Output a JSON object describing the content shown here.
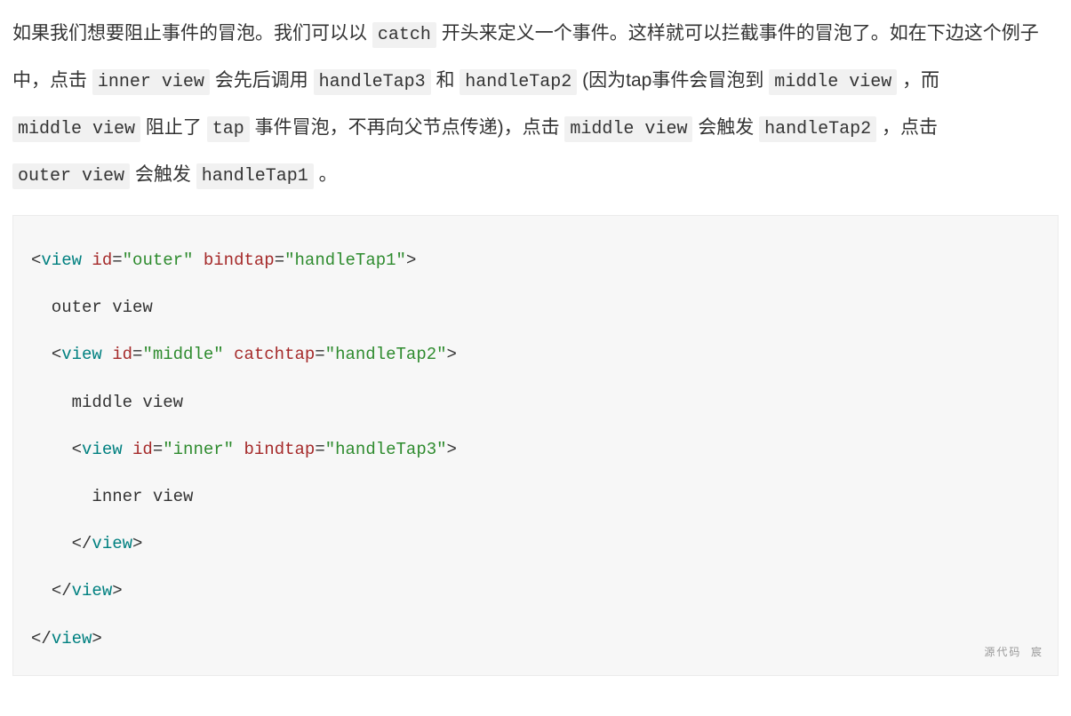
{
  "paragraph": {
    "p1": "如果我们想要阻止事件的冒泡。我们可以以",
    "c1": "catch",
    "p2": "开头来定义一个事件。这样就可以拦截事件的冒泡了。如在下边这个例子中，点击",
    "c2": "inner view",
    "p3": "会先后调用",
    "c3": "handleTap3",
    "p4": "和",
    "c4": "handleTap2",
    "p5": "(因为tap事件会冒泡到",
    "c5": "middle view",
    "p6": "，而",
    "c6": "middle view",
    "p7": "阻止了",
    "c7": "tap",
    "p8": "事件冒泡，不再向父节点传递)，点击",
    "c8": "middle view",
    "p9": "会触发",
    "c9": "handleTap2",
    "p10": "，点击",
    "c10": "outer view",
    "p11": "会触发",
    "c11": "handleTap1",
    "p12": "。"
  },
  "code": {
    "l1": {
      "lt": "<",
      "tag": "view",
      "sp1": " ",
      "a1": "id",
      "eq1": "=",
      "v1": "\"outer\"",
      "sp2": " ",
      "a2": "bindtap",
      "eq2": "=",
      "v2": "\"handleTap1\"",
      "gt": ">"
    },
    "l2": "  outer view",
    "l3": {
      "indent": "  ",
      "lt": "<",
      "tag": "view",
      "sp1": " ",
      "a1": "id",
      "eq1": "=",
      "v1": "\"middle\"",
      "sp2": " ",
      "a2": "catchtap",
      "eq2": "=",
      "v2": "\"handleTap2\"",
      "gt": ">"
    },
    "l4": "    middle view",
    "l5": {
      "indent": "    ",
      "lt": "<",
      "tag": "view",
      "sp1": " ",
      "a1": "id",
      "eq1": "=",
      "v1": "\"inner\"",
      "sp2": " ",
      "a2": "bindtap",
      "eq2": "=",
      "v2": "\"handleTap3\"",
      "gt": ">"
    },
    "l6": "      inner view",
    "l7": {
      "indent": "    ",
      "lt": "</",
      "tag": "view",
      "gt": ">"
    },
    "l8": {
      "indent": "  ",
      "lt": "</",
      "tag": "view",
      "gt": ">"
    },
    "l9": {
      "indent": "",
      "lt": "</",
      "tag": "view",
      "gt": ">"
    }
  },
  "watermark": "源代码  宸"
}
